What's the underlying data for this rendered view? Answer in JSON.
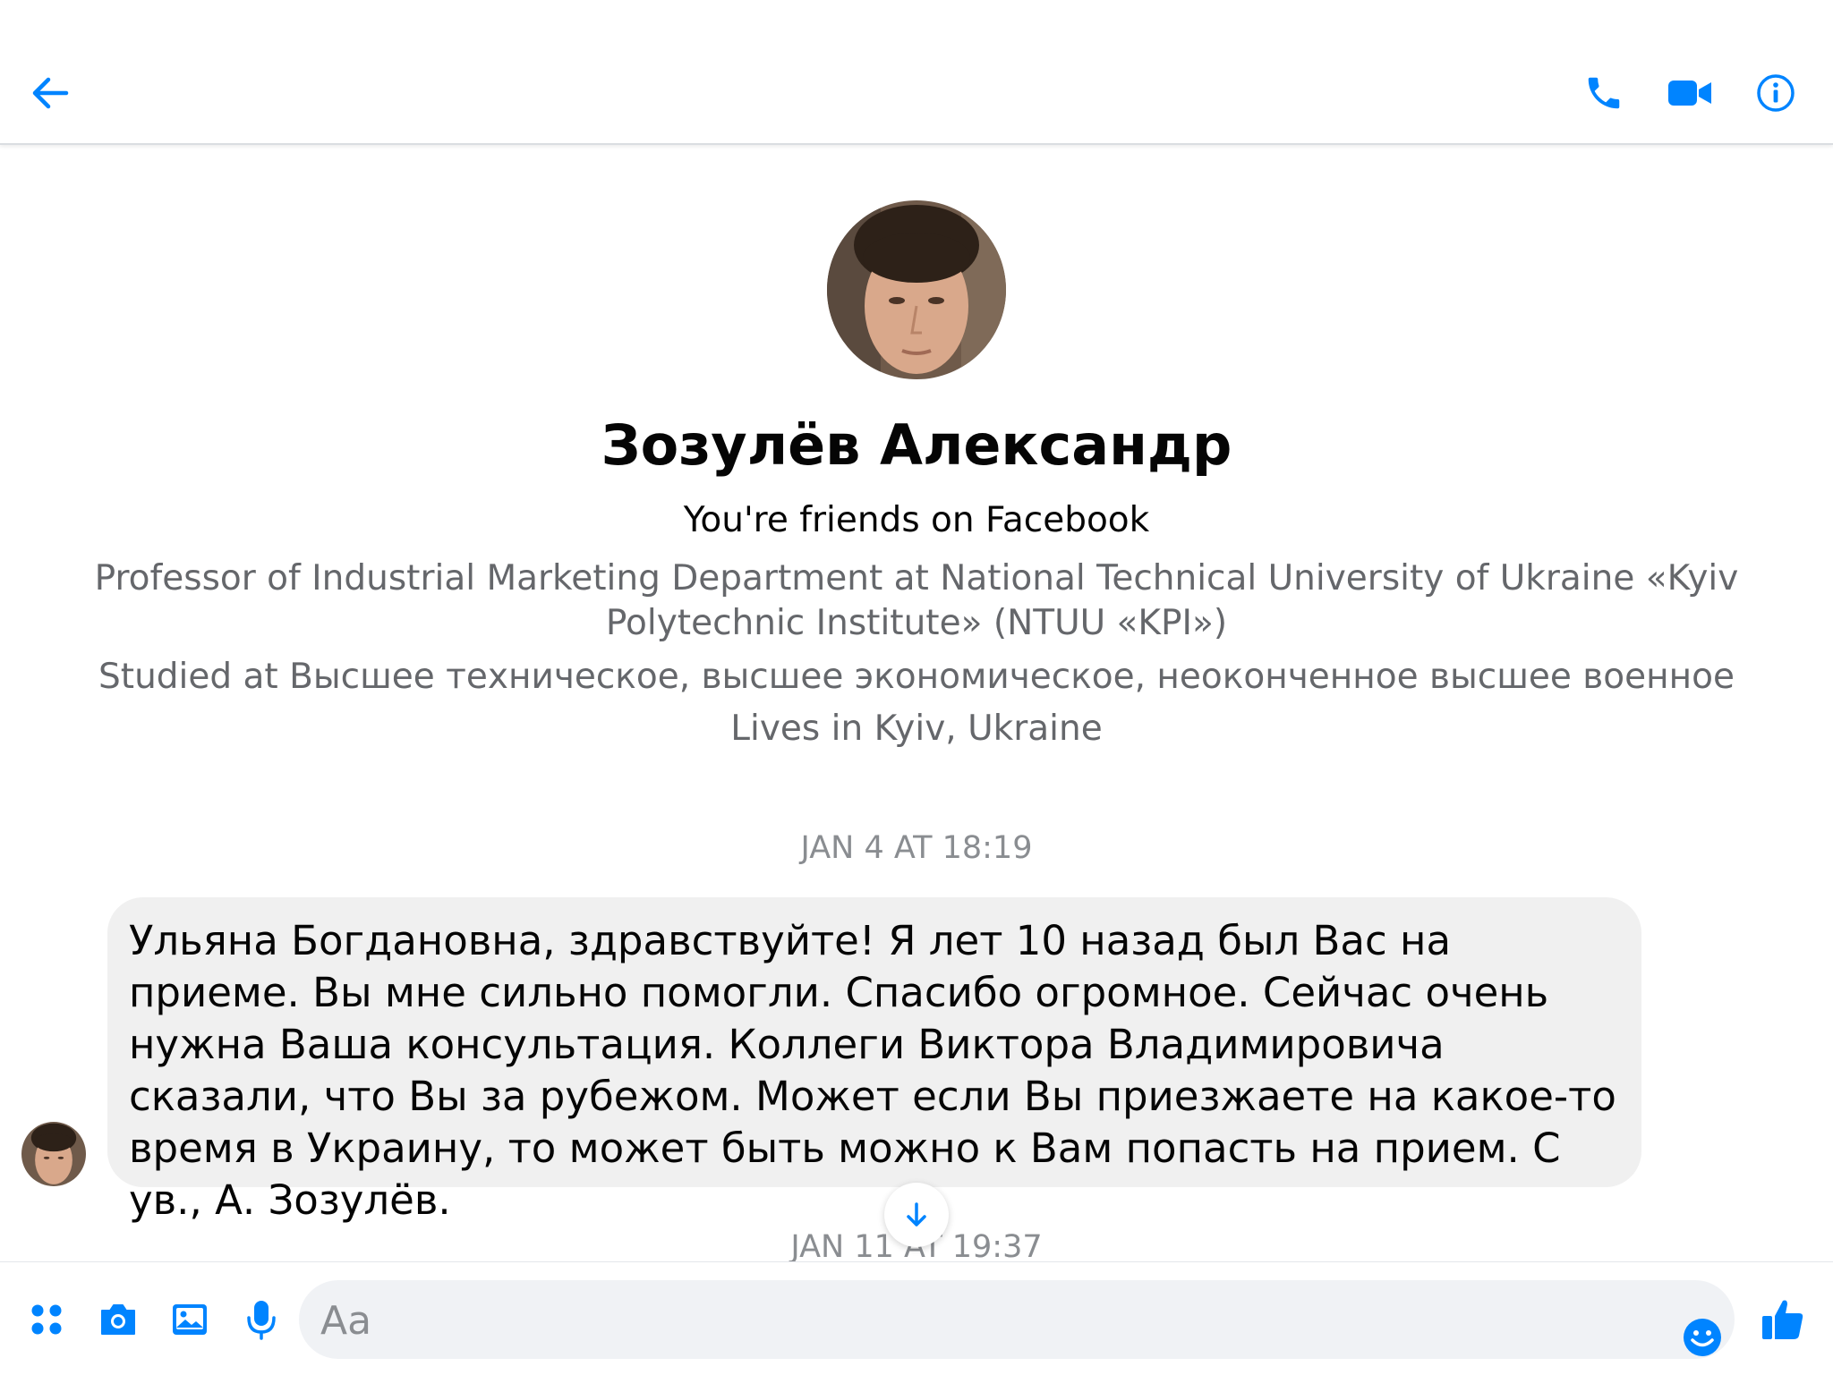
{
  "colors": {
    "accent": "#0084ff",
    "text_primary": "#050505",
    "text_secondary": "#65676b",
    "timestamp": "#8a8d91",
    "bubble_incoming": "#f0f0f0",
    "input_background": "#f0f2f5"
  },
  "header": {
    "icons": {
      "back": "arrow-left-icon",
      "call": "phone-icon",
      "video": "video-camera-icon",
      "info": "info-icon"
    }
  },
  "profile": {
    "name": "Зозулёв Александр",
    "friends_status": "You're friends on Facebook",
    "work": "Professor of Industrial Marketing Department at National Technical University of Ukraine «Kyiv Polytechnic Institute» (NTUU «KPI»)",
    "studied": "Studied at Высшее техническое, высшее экономическое, неоконченное высшее военное",
    "lives": "Lives in Kyiv, Ukraine"
  },
  "conversation": {
    "timestamp_1": "JAN 4 AT 18:19",
    "message_1": "Ульяна Богдановна, здравствуйте! Я лет 10 назад был Вас на приеме. Вы мне сильно помогли. Спасибо огромное. Сейчас очень нужна Ваша консультация. Коллеги Виктора Владимировича сказали, что Вы за рубежом. Может если Вы приезжаете на какое-то время в Украину, то может быть можно к Вам попасть на прием. С ув., А. Зозулёв.",
    "timestamp_2": "JAN 11 AT 19:37"
  },
  "composer": {
    "placeholder": "Aa",
    "value": "",
    "icons": {
      "apps": "apps-grid-icon",
      "camera": "camera-icon",
      "gallery": "image-icon",
      "mic": "microphone-icon",
      "emoji": "smiley-icon",
      "like": "thumbs-up-icon"
    }
  }
}
